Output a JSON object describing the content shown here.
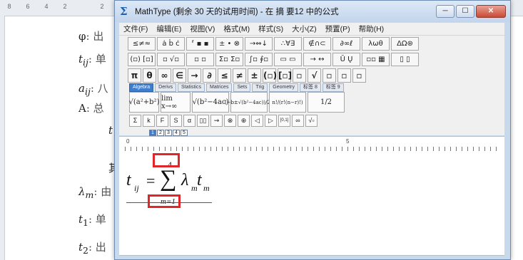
{
  "document": {
    "ruler_numbers": [
      "8",
      "6",
      "4",
      "2",
      "",
      "2"
    ],
    "lines": [
      {
        "symbol": "φ",
        "suffix": ": 出"
      },
      {
        "symbol": "t",
        "sub": "ij",
        "suffix": ": 单"
      },
      {
        "symbol": "a",
        "sub": "ij",
        "suffix": ": 八"
      },
      {
        "symbol": "A",
        "suffix": ": 总"
      },
      {
        "symbol": "t",
        "suffix": ""
      },
      {
        "symbol": "其",
        "suffix": ""
      },
      {
        "symbol": "λ",
        "sub": "m",
        "suffix": ": 由"
      },
      {
        "symbol": "t",
        "sub": "1",
        "suffix": ": 单"
      },
      {
        "symbol": "t",
        "sub": "2",
        "suffix": ": 出"
      }
    ]
  },
  "window": {
    "title": "MathType (剩余 30 天的试用时间) - 在 摘 要12 中的公式",
    "buttons": {
      "minimize": "─",
      "maximize": "☐",
      "close": "✕"
    }
  },
  "menu": [
    "文件(F)",
    "编辑(E)",
    "视图(V)",
    "格式(M)",
    "样式(S)",
    "大小(Z)",
    "预置(P)",
    "帮助(H)"
  ],
  "toolbar": {
    "row1": [
      "≤≠≈",
      "ȧ ḃ ċ",
      "⸢ ▪ ▪",
      "± • ⊗",
      "→⇔↓",
      "∴∀∃",
      "∉∩⊂",
      "∂∞ℓ",
      "λωθ",
      "ΔΩ⊛"
    ],
    "row2": [
      "(▫) [▫]",
      "▫ √▫",
      "▫ ▫",
      "Σ▫ Σ▫",
      "∫▫ ∮▫",
      "▭ ▭",
      "→ ↔",
      "Ū Ų",
      "▫▫ ▦",
      "▯ ▯"
    ],
    "row3": [
      "π",
      "θ",
      "∞",
      "∈",
      "→",
      "∂",
      "≤",
      "≠",
      "±",
      "(▫)",
      "[▫]",
      "▫",
      "√",
      "▫",
      "▫",
      "▫"
    ],
    "tabs": [
      "Algebra",
      "Derivs",
      "Statistics",
      "Matrices",
      "Sets",
      "Trig",
      "Geometry",
      "标签 8",
      "标签 9"
    ],
    "active_tab": "Algebra",
    "templates": [
      "√(a²+b²)",
      "lim x→∞",
      "√(b²−4ac)",
      "(−b±√(b²−4ac))/2a",
      "n!/(r!(n−r)!)",
      "1/2"
    ],
    "symbols": [
      "Σ",
      "k",
      "F",
      "S",
      "α",
      "▯▯",
      "⇝",
      "⊗",
      "⊕",
      "◁",
      "▷",
      "[0,1]",
      "∞",
      "√▫"
    ],
    "sizes": [
      "1",
      "2",
      "3",
      "4",
      "5"
    ],
    "active_size": "1"
  },
  "ruler": {
    "labels": [
      "0",
      "5"
    ]
  },
  "formula": {
    "lhs": "t",
    "lhs_sub": "ij",
    "equals": "=",
    "operator": "∑",
    "upper_limit": "4",
    "lower_limit": "m=1",
    "term1": "λ",
    "term1_sub": "m",
    "term2": "t",
    "term2_sub": "m"
  },
  "highlight_color": "#e1262a"
}
